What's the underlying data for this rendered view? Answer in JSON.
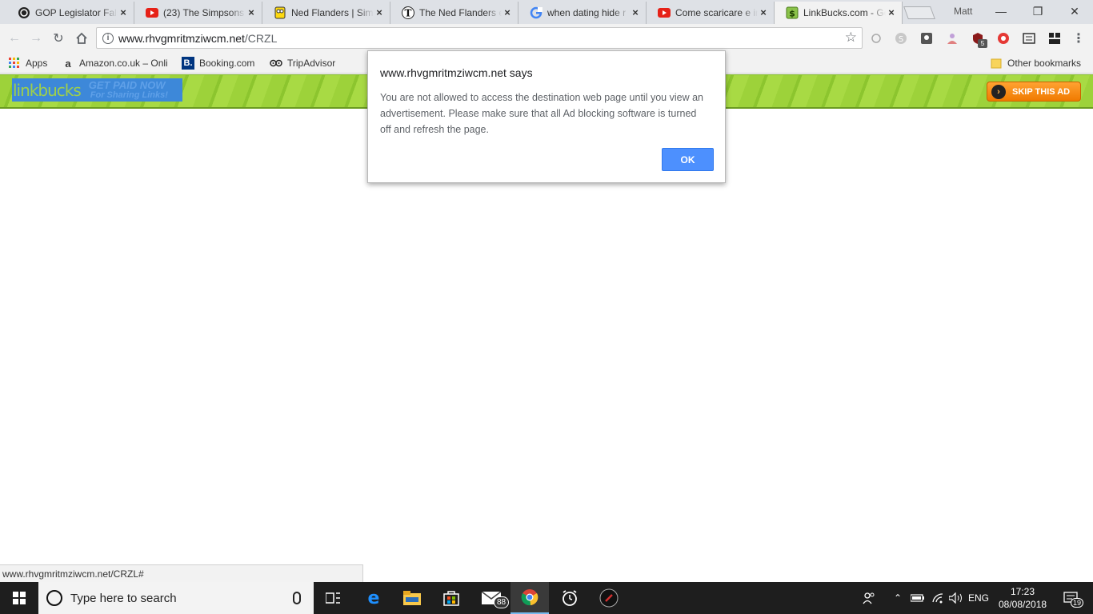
{
  "browser": {
    "tabs": [
      {
        "title": "GOP Legislator False",
        "icon": "spin-icon",
        "left": 0
      },
      {
        "title": "(23) The Simpsons",
        "icon": "youtube-icon"
      },
      {
        "title": "Ned Flanders | Simp",
        "icon": "simpsons-icon"
      },
      {
        "title": "The Ned Flanders e",
        "icon": "telegraph-icon"
      },
      {
        "title": "when dating hide r",
        "icon": "google-icon"
      },
      {
        "title": "Come scaricare e in",
        "icon": "youtube-icon"
      },
      {
        "title": "LinkBucks.com - Ge",
        "icon": "dollar-icon",
        "active": true
      }
    ],
    "profile_name": "Matt",
    "address": {
      "host": "www.rhvgmritmziwcm.net",
      "path": "/CRZL"
    },
    "bookmarks": [
      {
        "label": "Apps",
        "icon": "apps-grid-icon"
      },
      {
        "label": "Amazon.co.uk – Onli",
        "icon": "amazon-icon"
      },
      {
        "label": "Booking.com",
        "icon": "booking-icon"
      },
      {
        "label": "TripAdvisor",
        "icon": "tripadvisor-icon"
      }
    ],
    "other_bookmarks": "Other bookmarks",
    "extension_badge": "5"
  },
  "adbar": {
    "brand": "linkbucks",
    "tagline1": "GET PAID NOW",
    "tagline2": "For Sharing Links!",
    "skip_label": "SKIP THIS AD"
  },
  "dialog": {
    "title": "www.rhvgmritmziwcm.net says",
    "message": "You are not allowed to access the destination web page until you view an advertisement. Please make sure that all Ad blocking software is turned off and refresh the page.",
    "ok_label": "OK"
  },
  "status_url": "www.rhvgmritmziwcm.net/CRZL#",
  "taskbar": {
    "search_placeholder": "Type here to search",
    "mail_badge": "88",
    "language": "ENG",
    "time": "17:23",
    "date": "08/08/2018",
    "notifications": "19"
  },
  "colors": {
    "accent": "#4d90fe",
    "ad_green": "#9dd23a",
    "skip_orange": "#f07a00",
    "logo_blue": "#3d88d9"
  }
}
